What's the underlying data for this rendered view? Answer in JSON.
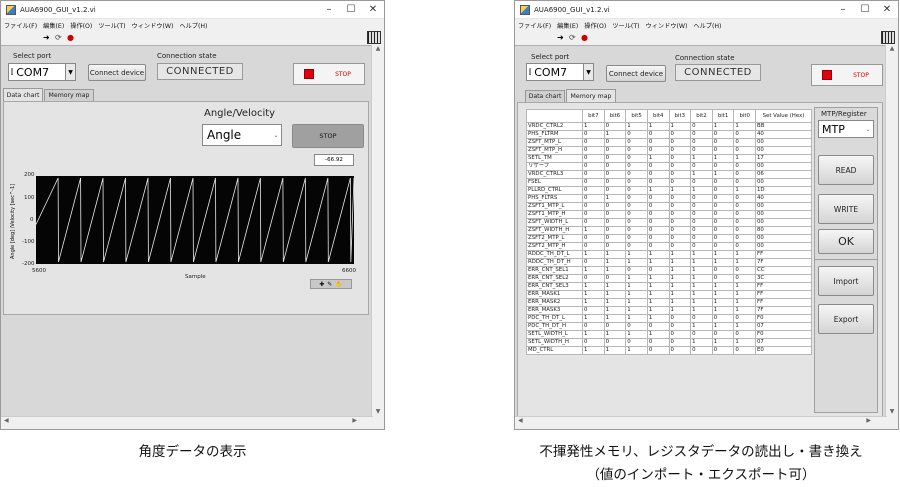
{
  "left": {
    "title": "AUA6900_GUI_v1.2.vi",
    "menu": [
      "ファイル(F)",
      "編集(E)",
      "操作(O)",
      "ツール(T)",
      "ウィンドウ(W)",
      "ヘルプ(H)"
    ],
    "select_port_label": "Select port",
    "port_value": "COM7",
    "connect_label": "Connect device",
    "connection_state_label": "Connection state",
    "connection_state": "CONNECTED",
    "stop_label": "STOP",
    "tabs": [
      "Data chart",
      "Memory map"
    ],
    "angle_velocity_label": "Angle/Velocity",
    "angle_value": "Angle",
    "stop2_label": "STOP",
    "readout": "-66.92",
    "chart": {
      "ylabel": "Angle [deg] /Velocity [sec^-1]",
      "xlabel": "Sample",
      "yticks": [
        "200",
        "100",
        "0",
        "-100",
        "-200"
      ],
      "xticks": [
        "5600",
        "6600"
      ]
    }
  },
  "right": {
    "title": "AUA6900_GUI_v1.2.vi",
    "menu": [
      "ファイル(F)",
      "編集(E)",
      "操作(O)",
      "ツール(T)",
      "ウィンドウ(W)",
      "ヘルプ(H)"
    ],
    "select_port_label": "Select port",
    "port_value": "COM7",
    "connect_label": "Connect device",
    "connection_state_label": "Connection state",
    "connection_state": "CONNECTED",
    "stop_label": "STOP",
    "tabs": [
      "Data chart",
      "Memory map"
    ],
    "table_headers": [
      "",
      "bit7",
      "bit6",
      "bit5",
      "bit4",
      "bit3",
      "bit2",
      "bit1",
      "bit0",
      "Set Value (Hex)"
    ],
    "rows": [
      [
        "VRDC_CTRL2",
        "1",
        "0",
        "1",
        "1",
        "1",
        "0",
        "1",
        "1",
        "BB"
      ],
      [
        "PHS_FLTRM",
        "0",
        "1",
        "0",
        "0",
        "0",
        "0",
        "0",
        "0",
        "40"
      ],
      [
        "ZSFT_MTP_L",
        "0",
        "0",
        "0",
        "0",
        "0",
        "0",
        "0",
        "0",
        "00"
      ],
      [
        "ZSFT_MTP_H",
        "0",
        "0",
        "0",
        "0",
        "0",
        "0",
        "0",
        "0",
        "00"
      ],
      [
        "SETL_TM",
        "0",
        "0",
        "0",
        "1",
        "0",
        "1",
        "1",
        "1",
        "17"
      ],
      [
        "リザーブ",
        "0",
        "0",
        "0",
        "0",
        "0",
        "0",
        "0",
        "0",
        "00"
      ],
      [
        "VRDC_CTRL3",
        "0",
        "0",
        "0",
        "0",
        "0",
        "1",
        "1",
        "0",
        "06"
      ],
      [
        "FSEL",
        "0",
        "0",
        "0",
        "0",
        "0",
        "0",
        "0",
        "0",
        "00"
      ],
      [
        "PLLRD_CTRL",
        "0",
        "0",
        "0",
        "1",
        "1",
        "1",
        "0",
        "1",
        "1D"
      ],
      [
        "PHS_FLTRS",
        "0",
        "1",
        "0",
        "0",
        "0",
        "0",
        "0",
        "0",
        "40"
      ],
      [
        "ZSFT1_MTP_L",
        "0",
        "0",
        "0",
        "0",
        "0",
        "0",
        "0",
        "0",
        "00"
      ],
      [
        "ZSFT1_MTP_H",
        "0",
        "0",
        "0",
        "0",
        "0",
        "0",
        "0",
        "0",
        "00"
      ],
      [
        "ZSFT_WIDTH_L",
        "0",
        "0",
        "0",
        "0",
        "0",
        "0",
        "0",
        "0",
        "00"
      ],
      [
        "ZSFT_WIDTH_H",
        "1",
        "0",
        "0",
        "0",
        "0",
        "0",
        "0",
        "0",
        "80"
      ],
      [
        "ZSFT2_MTP_L",
        "0",
        "0",
        "0",
        "0",
        "0",
        "0",
        "0",
        "0",
        "00"
      ],
      [
        "ZSFT2_MTP_H",
        "0",
        "0",
        "0",
        "0",
        "0",
        "0",
        "0",
        "0",
        "00"
      ],
      [
        "RDDC_TH_DT_L",
        "1",
        "1",
        "1",
        "1",
        "1",
        "1",
        "1",
        "1",
        "FF"
      ],
      [
        "RDDC_TH_DT_H",
        "0",
        "1",
        "1",
        "1",
        "1",
        "1",
        "1",
        "1",
        "7F"
      ],
      [
        "ERR_CNT_SEL1",
        "1",
        "1",
        "0",
        "0",
        "1",
        "1",
        "0",
        "0",
        "CC"
      ],
      [
        "ERR_CNT_SEL2",
        "0",
        "0",
        "1",
        "1",
        "1",
        "1",
        "0",
        "0",
        "3C"
      ],
      [
        "ERR_CNT_SEL3",
        "1",
        "1",
        "1",
        "1",
        "1",
        "1",
        "1",
        "1",
        "FF"
      ],
      [
        "ERR_MASK1",
        "1",
        "1",
        "1",
        "1",
        "1",
        "1",
        "1",
        "1",
        "FF"
      ],
      [
        "ERR_MASK2",
        "1",
        "1",
        "1",
        "1",
        "1",
        "1",
        "1",
        "1",
        "FF"
      ],
      [
        "ERR_MASK3",
        "0",
        "1",
        "1",
        "1",
        "1",
        "1",
        "1",
        "1",
        "7F"
      ],
      [
        "PDC_TH_DT_L",
        "1",
        "1",
        "1",
        "1",
        "0",
        "0",
        "0",
        "0",
        "F0"
      ],
      [
        "PDC_TH_DT_H",
        "0",
        "0",
        "0",
        "0",
        "0",
        "1",
        "1",
        "1",
        "07"
      ],
      [
        "SETL_WIDTH_L",
        "1",
        "1",
        "1",
        "1",
        "0",
        "0",
        "0",
        "0",
        "F0"
      ],
      [
        "SETL_WIDTH_H",
        "0",
        "0",
        "0",
        "0",
        "0",
        "1",
        "1",
        "1",
        "07"
      ],
      [
        "MD_CTRL",
        "1",
        "1",
        "1",
        "0",
        "0",
        "0",
        "0",
        "0",
        "E0"
      ]
    ],
    "mtp_register_label": "MTP/Register",
    "mtp_value": "MTP",
    "read_label": "READ",
    "write_label": "WRITE",
    "ok_label": "OK",
    "import_label": "Import",
    "export_label": "Export"
  },
  "captions": {
    "left": "角度データの表示",
    "right_line1": "不揮発性メモリ、レジスタデータの読出し・書き換え",
    "right_line2": "（値のインポート・エクスポート可）"
  }
}
